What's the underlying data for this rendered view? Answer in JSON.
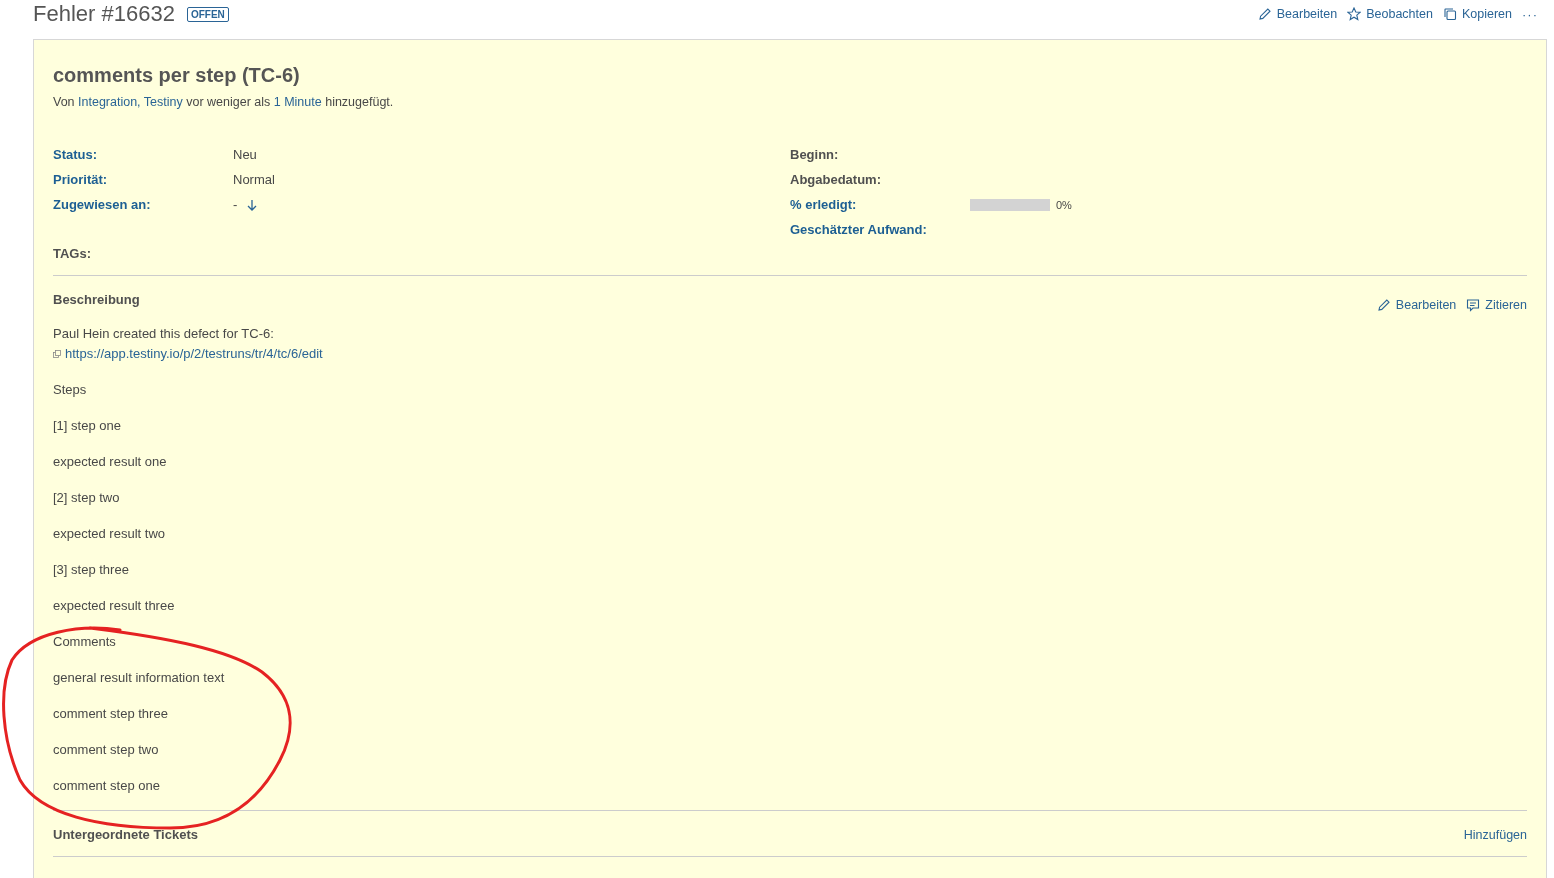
{
  "header": {
    "title": "Fehler #16632",
    "badge": "OFFEN",
    "actions": [
      {
        "kind": "edit",
        "label": "Bearbeiten"
      },
      {
        "kind": "watch",
        "label": "Beobachten"
      },
      {
        "kind": "copy",
        "label": "Kopieren"
      }
    ],
    "more": "···"
  },
  "issue": {
    "subject": "comments per step (TC-6)",
    "byline": {
      "prefix": "Von",
      "author": "Integration, Testiny",
      "middle": "vor weniger als",
      "time": "1 Minute",
      "suffix": "hinzugefügt."
    }
  },
  "attributes_left": [
    {
      "label": "Status:",
      "linked": true,
      "value": "Neu"
    },
    {
      "label": "Priorität:",
      "linked": true,
      "value": "Normal"
    },
    {
      "label": "Zugewiesen an:",
      "linked": true,
      "value": "-",
      "assign_icon": true
    }
  ],
  "attributes_right": [
    {
      "label": "Beginn:",
      "linked": false
    },
    {
      "label": "Abgabedatum:",
      "linked": false
    },
    {
      "label": "% erledigt:",
      "linked": true,
      "kind": "progress",
      "level": 0,
      "reading": "0%"
    },
    {
      "label": "Geschätzter Aufwand:",
      "linked": true
    }
  ],
  "tags": {
    "label": "TAGs:"
  },
  "description": {
    "heading": "Beschreibung",
    "actions": [
      {
        "kind": "edit",
        "label": "Bearbeiten"
      },
      {
        "kind": "quote",
        "label": "Zitieren"
      }
    ],
    "intro": "Paul Hein created this defect for TC-6:",
    "url": "https://app.testiny.io/p/2/testruns/tr/4/tc/6/edit",
    "paragraphs": [
      "Steps",
      "[1] step one",
      "expected result one",
      "[2] step two",
      "expected result two",
      "[3] step three",
      "expected result three",
      "Comments",
      "general result information text",
      "comment step three",
      "comment step two",
      "comment step one"
    ]
  },
  "subtasks": {
    "heading": "Untergeordnete Tickets",
    "action": "Hinzufügen"
  }
}
